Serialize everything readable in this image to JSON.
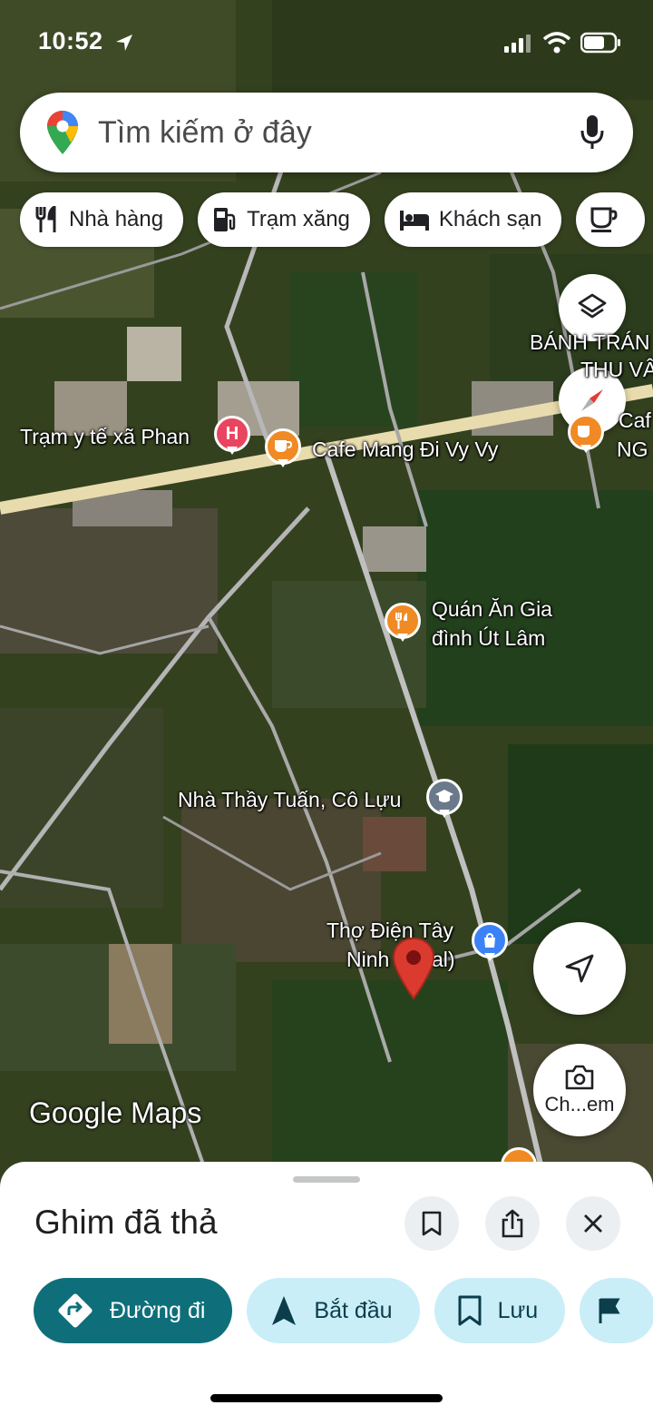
{
  "status_bar": {
    "time": "10:52"
  },
  "search": {
    "placeholder": "Tìm kiếm ở đây"
  },
  "chips": [
    {
      "label": "Nhà hàng",
      "icon": "fork-knife-icon"
    },
    {
      "label": "Trạm xăng",
      "icon": "gas-station-icon"
    },
    {
      "label": "Khách sạn",
      "icon": "bed-icon"
    }
  ],
  "map": {
    "labels": {
      "banh_trang": "BÁNH TRÁN",
      "banh_trang_2": "THU VÂ",
      "tram_y_te": "Trạm y tế xã Phan",
      "cafe_mang_di": "Cafe Mang Đi Vy Vy",
      "cafe_right_1": "Caf",
      "cafe_right_2": "NG",
      "quan_an_1": "Quán Ăn Gia",
      "quan_an_2": "đình Út Lâm",
      "nha_thay": "Nhà Thầy Tuấn, Cô Lựu",
      "tho_dien_1": "Thợ Điện Tây",
      "tho_dien_2": "Ninh",
      "tho_dien_3": "al)"
    },
    "watermark": "Google Maps",
    "camera_label": "Ch...em"
  },
  "sheet": {
    "title": "Ghim đã thả",
    "actions": [
      {
        "label": "Đường đi",
        "icon": "directions-icon"
      },
      {
        "label": "Bắt đầu",
        "icon": "navigation-arrow-icon"
      },
      {
        "label": "Lưu",
        "icon": "bookmark-icon"
      }
    ]
  },
  "colors": {
    "primary": "#0e6f7a",
    "secondary_bg": "#c9eef7",
    "pin": "#db3b2f",
    "poi_orange": "#f08a24",
    "poi_red": "#e94560",
    "poi_gray": "#6b7a8a",
    "poi_blue": "#3b82f6"
  }
}
